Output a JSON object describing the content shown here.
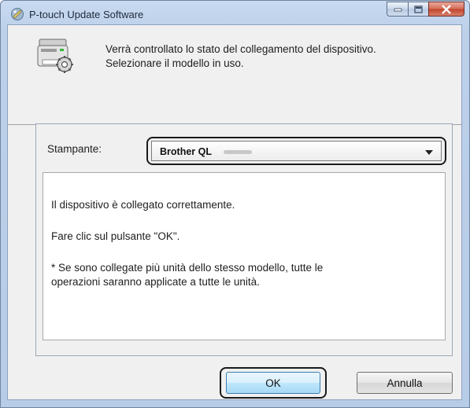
{
  "window": {
    "title": "P-touch Update Software"
  },
  "header": {
    "message_line1": "Verrà controllato lo stato del collegamento del dispositivo.",
    "message_line2": "Selezionare il modello in uso."
  },
  "printer": {
    "label": "Stampante:",
    "selected": "Brother QL"
  },
  "info": {
    "line1": "Il dispositivo è collegato correttamente.",
    "line2": "Fare clic sul pulsante \"OK\".",
    "line3": "* Se sono collegate più unità dello stesso modello, tutte le",
    "line4": "operazioni saranno applicate a tutte le unità."
  },
  "buttons": {
    "ok": "OK",
    "cancel": "Annulla"
  },
  "icons": {
    "app": "ptouch-app-icon",
    "device": "printer-settings-icon"
  }
}
